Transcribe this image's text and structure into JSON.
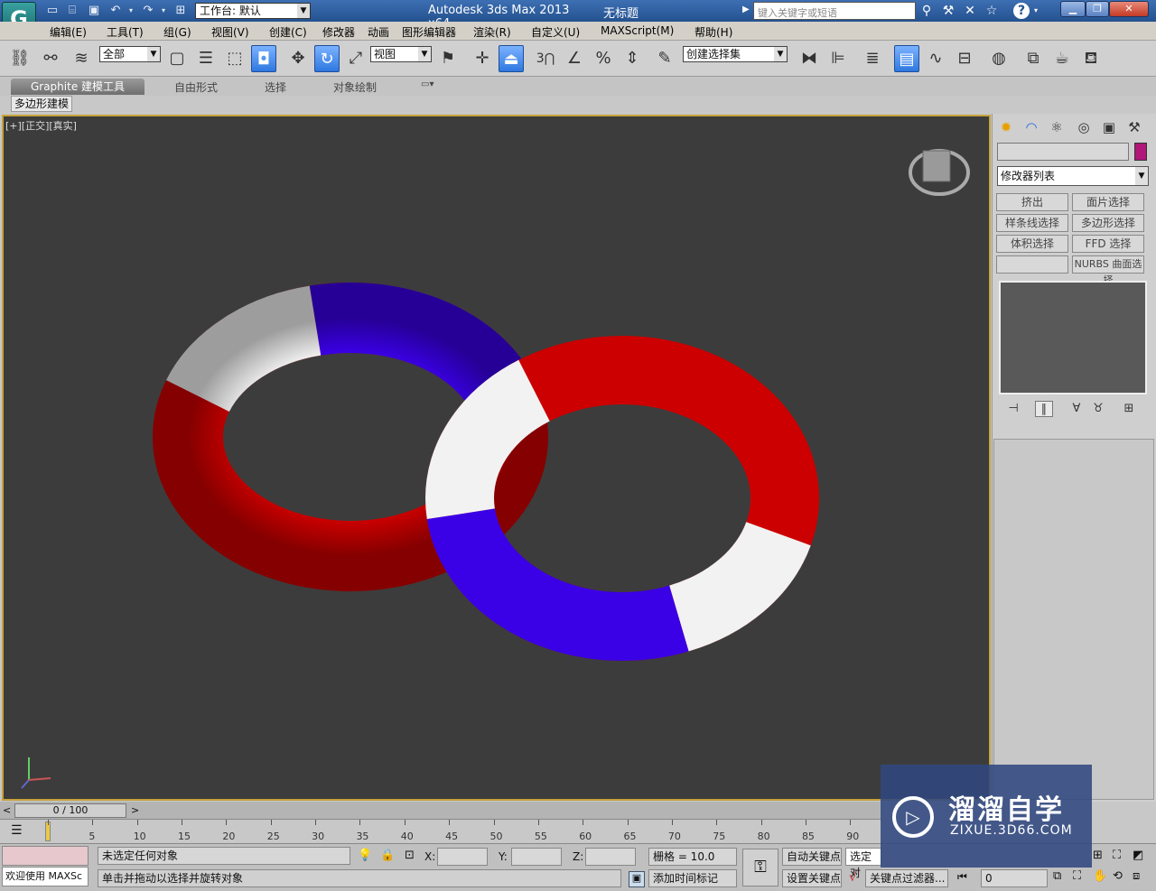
{
  "title_bar": {
    "logo": "G",
    "workspace_value": "工作台: 默认",
    "app_name": "Autodesk 3ds Max  2013 x64",
    "document_title": "无标题",
    "search_placeholder": "键入关键字或短语"
  },
  "menu": [
    "编辑(E)",
    "工具(T)",
    "组(G)",
    "视图(V)",
    "创建(C)",
    "修改器",
    "动画",
    "图形编辑器",
    "渲染(R)",
    "自定义(U)",
    "MAXScript(M)",
    "帮助(H)"
  ],
  "toolbar": {
    "selection_filter": "全部",
    "ref_coord": "视图",
    "named_selection": "创建选择集",
    "snap_label": "3"
  },
  "ribbon": {
    "tabs": [
      "Graphite 建模工具",
      "自由形式",
      "选择",
      "对象绘制"
    ],
    "subtab": "多边形建模"
  },
  "viewport": {
    "label": "[+][正交][真实]",
    "background": "#3c3c3c",
    "border_color": "#c6a23a",
    "ring_colors": {
      "red": "#cc0000",
      "blue": "#3a00e6",
      "white": "#f2f2f2"
    }
  },
  "command_panel": {
    "modifier_list": "修改器列表",
    "object_color": "#b01778",
    "buttons": [
      "挤出",
      "面片选择",
      "样条线选择",
      "多边形选择",
      "体积选择",
      "FFD 选择",
      "",
      "NURBS 曲面选择"
    ]
  },
  "timeline": {
    "slider_text": "0 / 100",
    "ticks": [
      "0",
      "5",
      "10",
      "15",
      "20",
      "25",
      "30",
      "35",
      "40",
      "45",
      "50",
      "55",
      "60",
      "65",
      "70",
      "75",
      "80",
      "85",
      "90"
    ]
  },
  "status": {
    "welcome": "欢迎使用 MAXSc",
    "selection_status": "未选定任何对象",
    "prompt": "单击并拖动以选择并旋转对象",
    "x_label": "X:",
    "y_label": "Y:",
    "z_label": "Z:",
    "grid": "栅格 = 10.0",
    "add_time_tag": "添加时间标记",
    "auto_key": "自动关键点",
    "selected": "选定对",
    "set_key": "设置关键点",
    "key_filter": "关键点过滤器...",
    "frame": "0"
  },
  "watermark": {
    "title": "溜溜自学",
    "subtitle": "ZIXUE.3D66.COM"
  }
}
